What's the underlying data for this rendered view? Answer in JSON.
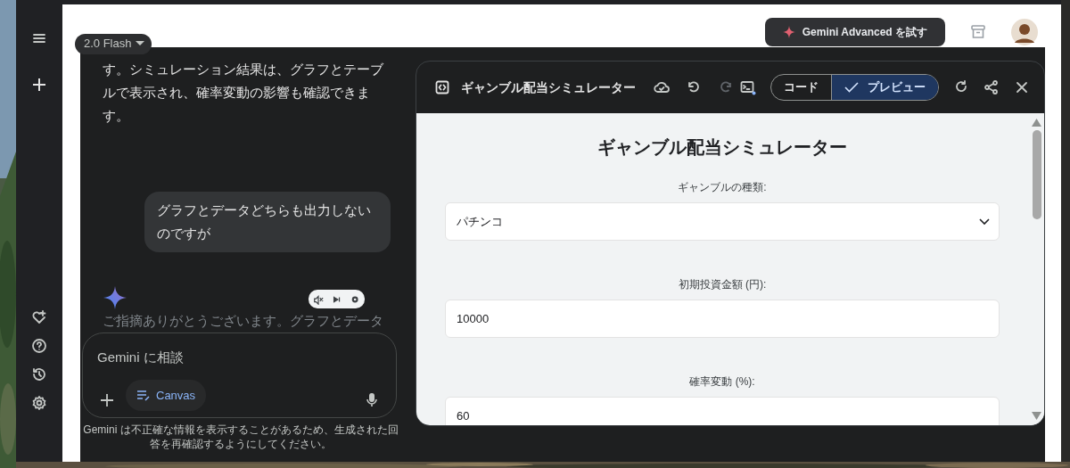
{
  "model_selector": {
    "label": "2.0 Flash"
  },
  "header": {
    "upgrade_button": "Gemini Advanced を試す"
  },
  "chat": {
    "messages": [
      {
        "kind": "response",
        "faded": false,
        "text": "す。シミュレーション結果は、グラフとテーブルで表示され、確率変動の影響も確認できます。"
      },
      {
        "kind": "user",
        "faded": false,
        "text": "グラフとデータどちらも出力しないのですが"
      },
      {
        "kind": "response",
        "faded": true,
        "text": "ご指摘ありがとうございます。グラフとデータ"
      }
    ]
  },
  "input": {
    "placeholder": "Gemini に相談",
    "tool_chip": "Canvas"
  },
  "disclaimer": "Gemini は不正確な情報を表示することがあるため、生成された回答を再確認するようにしてください。",
  "canvas": {
    "title": "ギャンブル配当シミュレーター",
    "tabs": [
      {
        "label": "コード",
        "selected": false
      },
      {
        "label": "プレビュー",
        "selected": true
      }
    ],
    "preview": {
      "heading": "ギャンブル配当シミュレーター",
      "fields": [
        {
          "kind": "select",
          "label": "ギャンブルの種類:",
          "value": "パチンコ"
        },
        {
          "kind": "input",
          "label": "初期投資金額 (円):",
          "value": "10000"
        },
        {
          "kind": "input",
          "label": "確率変動 (%):",
          "value": "60"
        }
      ]
    }
  }
}
